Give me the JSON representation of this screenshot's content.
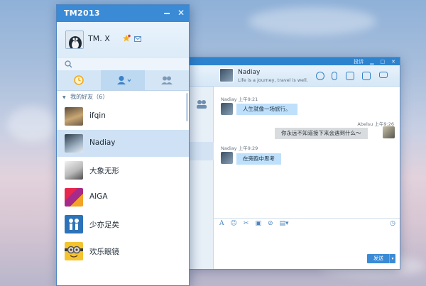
{
  "main_window": {
    "title": "TM2013",
    "profile_name": "TM. X",
    "group": {
      "label": "我的好友（6）"
    },
    "contacts": [
      {
        "name": "ifqin"
      },
      {
        "name": "Nadiay"
      },
      {
        "name": "大象无形"
      },
      {
        "name": "AIGA"
      },
      {
        "name": "少亦足矣"
      },
      {
        "name": "欢乐眼镜"
      }
    ]
  },
  "chat_window": {
    "titlebar_label": "投诉",
    "contact_name": "Nadiay",
    "signature": "Life is a journey, travel is well.",
    "messages": [
      {
        "sender": "Nadiay",
        "time": "上午9:21",
        "text": "人生就像一场旅行。"
      },
      {
        "sender": "Abelsu",
        "time": "上午9:26",
        "text": "你永远不知道接下来会遇到什么～"
      },
      {
        "sender": "Nadiay",
        "time": "上午9:29",
        "text": "在旁跑中思考"
      }
    ],
    "send_label": "发送"
  },
  "colors": {
    "accent": "#3a8ad5",
    "incoming_bubble": "#bfe0fb",
    "outgoing_bubble": "#d9dcdf"
  }
}
